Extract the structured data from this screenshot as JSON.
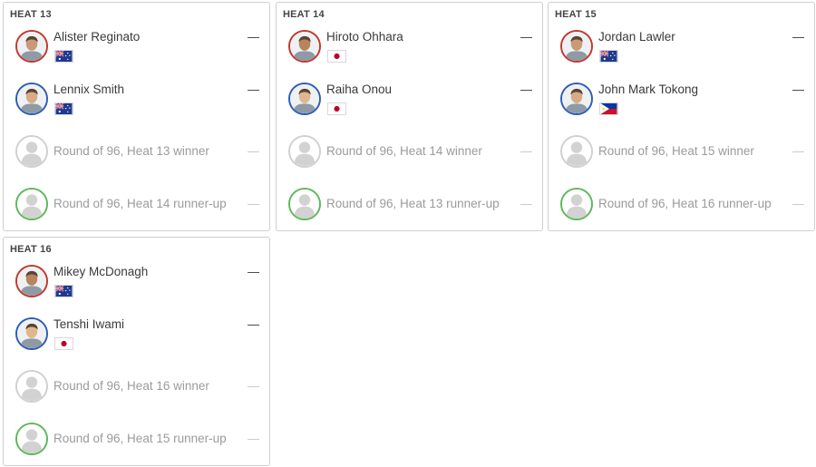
{
  "colors": {
    "ring_red": "#c0392b",
    "ring_blue": "#2f5bb5",
    "ring_green": "#5cb85c",
    "ring_grey": "#d0d0d0",
    "placeholder_text": "#9b9b9b"
  },
  "heats": [
    {
      "title": "HEAT 13",
      "athletes": [
        {
          "name": "Alister Reginato",
          "score": "—",
          "ring": "red",
          "flag": "australia-flag",
          "placeholder": false
        },
        {
          "name": "Lennix Smith",
          "score": "—",
          "ring": "blue",
          "flag": "australia-flag",
          "placeholder": false
        },
        {
          "name": "Round of 96, Heat 13 winner",
          "score": "—",
          "ring": "grey",
          "flag": "",
          "placeholder": true
        },
        {
          "name": "Round of 96, Heat 14 runner-up",
          "score": "—",
          "ring": "green",
          "flag": "",
          "placeholder": true
        }
      ]
    },
    {
      "title": "HEAT 14",
      "athletes": [
        {
          "name": "Hiroto Ohhara",
          "score": "—",
          "ring": "red",
          "flag": "japan-flag",
          "placeholder": false
        },
        {
          "name": "Raiha Onou",
          "score": "—",
          "ring": "blue",
          "flag": "japan-flag",
          "placeholder": false
        },
        {
          "name": "Round of 96, Heat 14 winner",
          "score": "—",
          "ring": "grey",
          "flag": "",
          "placeholder": true
        },
        {
          "name": "Round of 96, Heat 13 runner-up",
          "score": "—",
          "ring": "green",
          "flag": "",
          "placeholder": true
        }
      ]
    },
    {
      "title": "HEAT 15",
      "athletes": [
        {
          "name": "Jordan Lawler",
          "score": "—",
          "ring": "red",
          "flag": "australia-flag",
          "placeholder": false
        },
        {
          "name": "John Mark Tokong",
          "score": "—",
          "ring": "blue",
          "flag": "philippines-flag",
          "placeholder": false
        },
        {
          "name": "Round of 96, Heat 15 winner",
          "score": "—",
          "ring": "grey",
          "flag": "",
          "placeholder": true
        },
        {
          "name": "Round of 96, Heat 16 runner-up",
          "score": "—",
          "ring": "green",
          "flag": "",
          "placeholder": true
        }
      ]
    },
    {
      "title": "HEAT 16",
      "athletes": [
        {
          "name": "Mikey McDonagh",
          "score": "—",
          "ring": "red",
          "flag": "australia-flag",
          "placeholder": false
        },
        {
          "name": "Tenshi Iwami",
          "score": "—",
          "ring": "blue",
          "flag": "japan-flag",
          "placeholder": false
        },
        {
          "name": "Round of 96, Heat 16 winner",
          "score": "—",
          "ring": "grey",
          "flag": "",
          "placeholder": true
        },
        {
          "name": "Round of 96, Heat 15 runner-up",
          "score": "—",
          "ring": "green",
          "flag": "",
          "placeholder": true
        }
      ]
    }
  ]
}
